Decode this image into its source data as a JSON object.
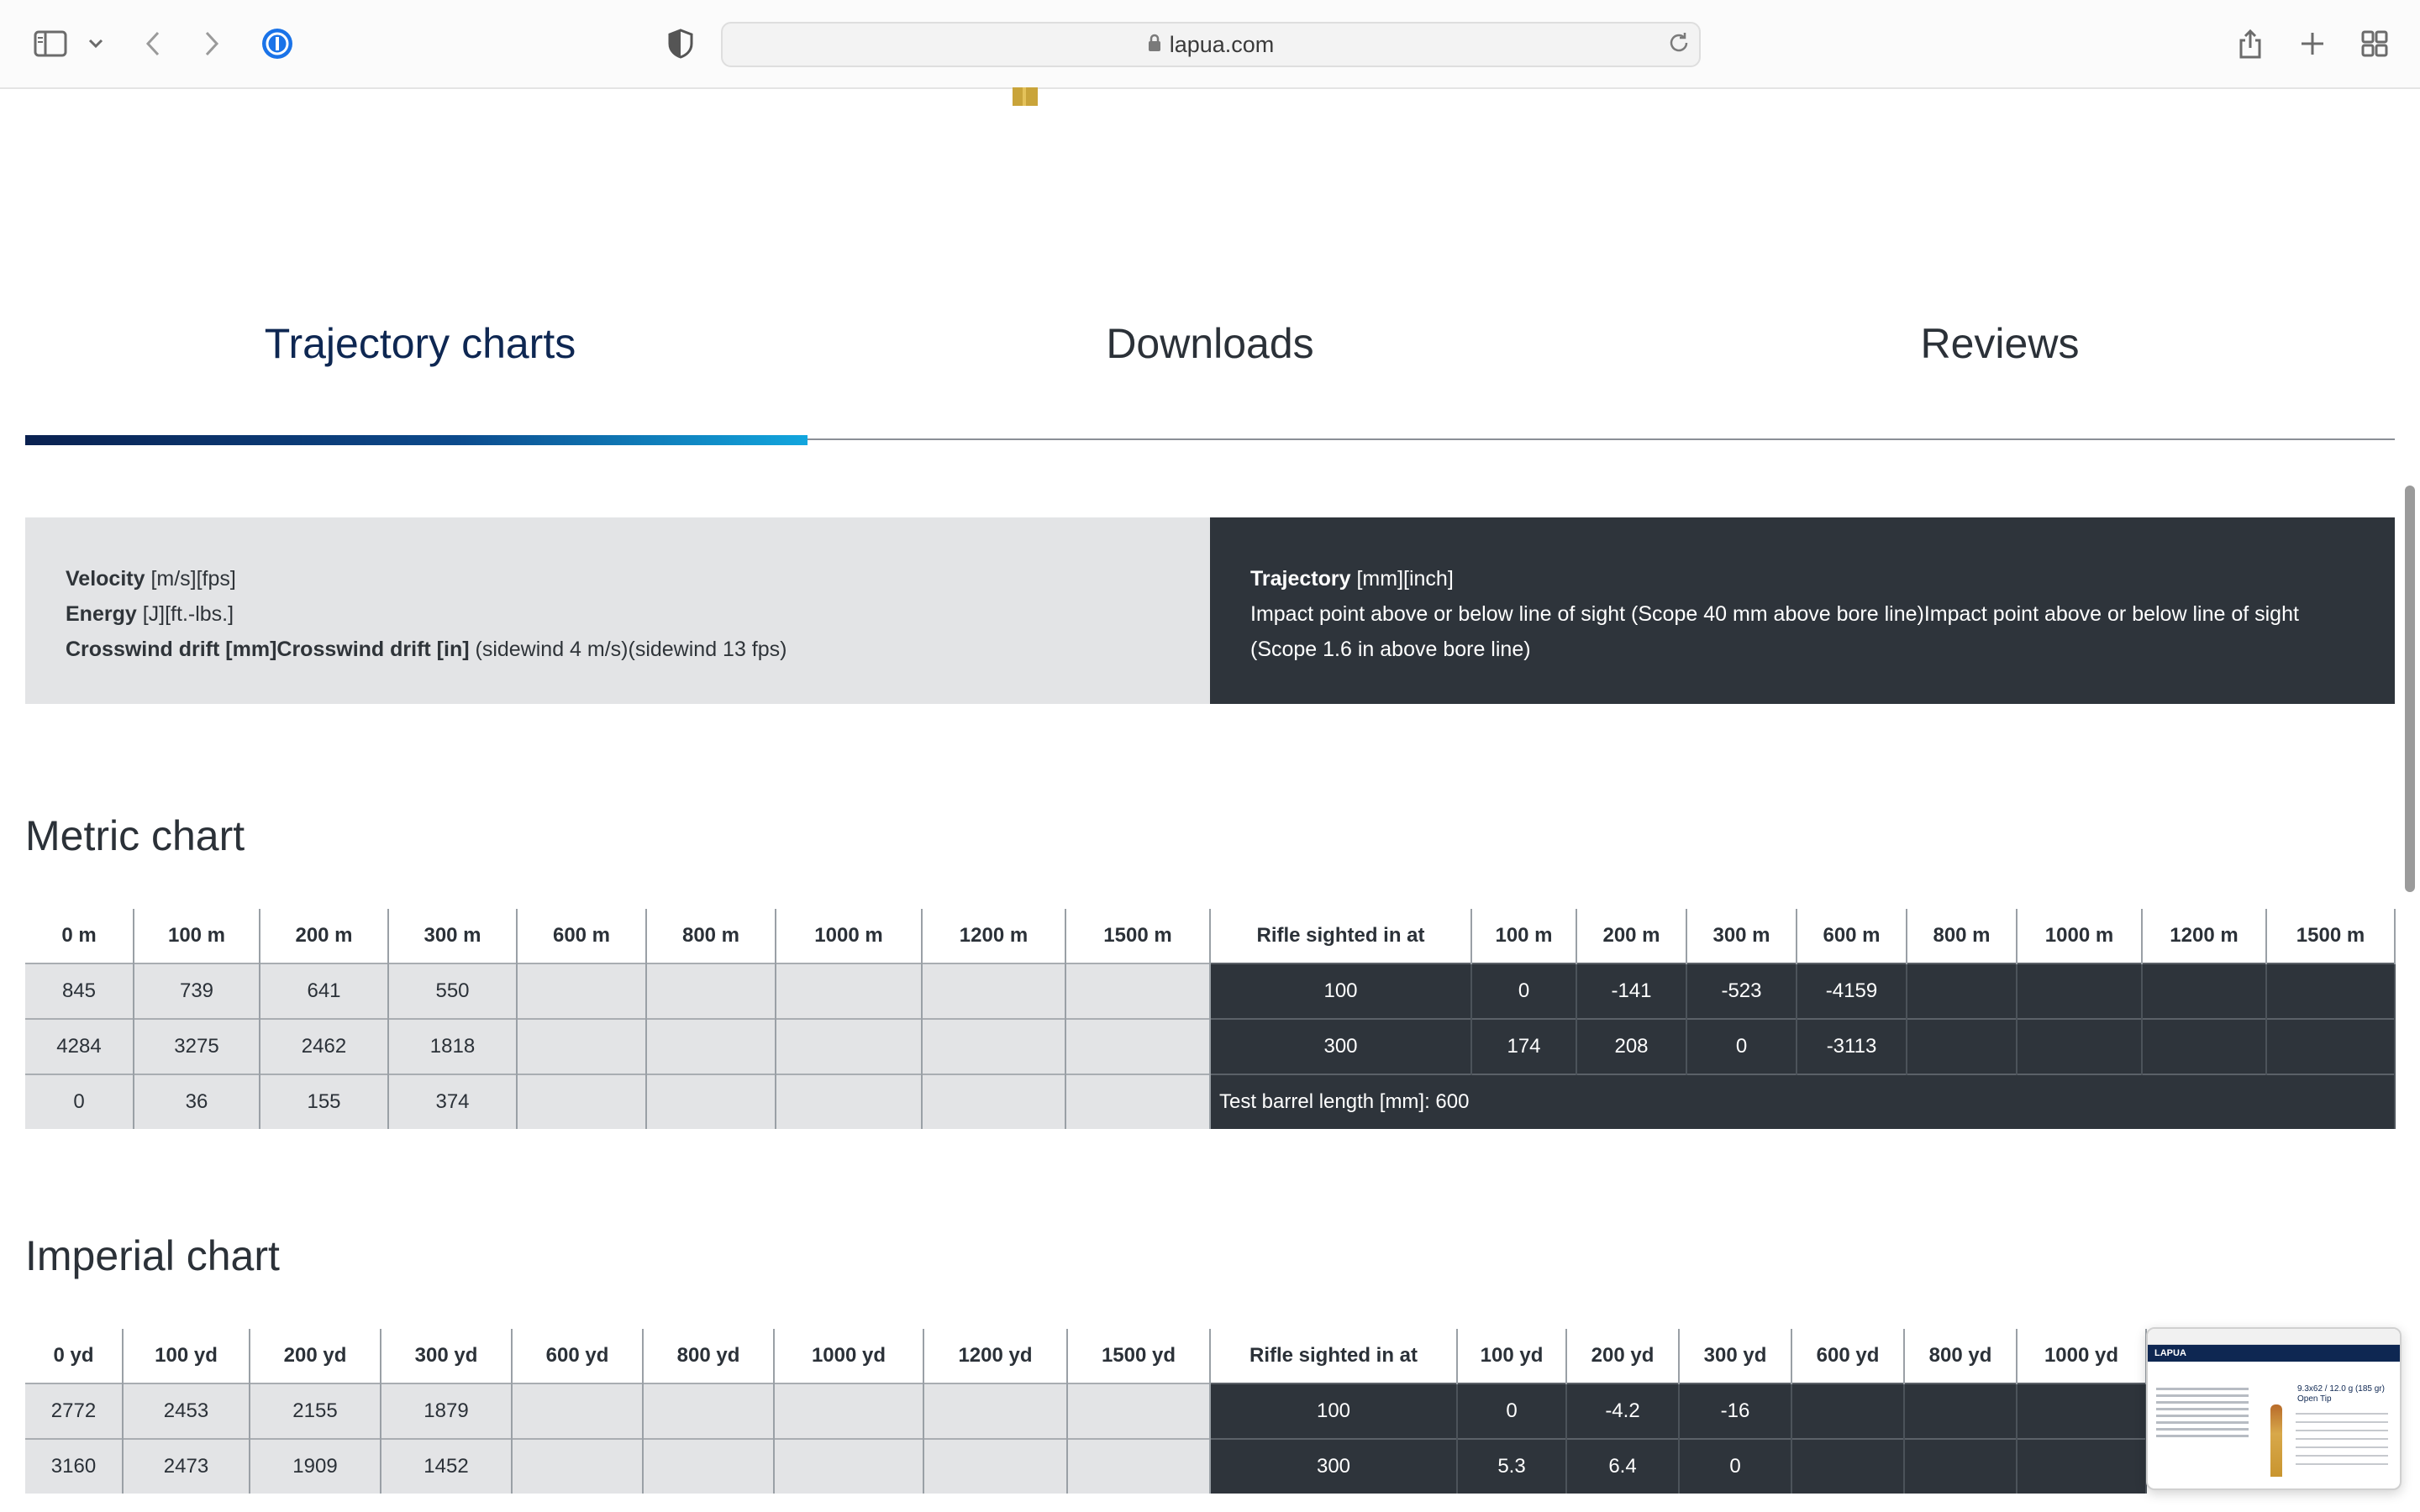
{
  "browser": {
    "url": "lapua.com"
  },
  "tabs": [
    {
      "label": "Trajectory charts",
      "active": true
    },
    {
      "label": "Downloads",
      "active": false
    },
    {
      "label": "Reviews",
      "active": false
    }
  ],
  "legend": {
    "velocity_label": "Velocity",
    "velocity_units": "[m/s][fps]",
    "energy_label": "Energy",
    "energy_units": "[J][ft.-lbs.]",
    "drift_label": "Crosswind drift [mm]Crosswind drift [in]",
    "drift_note": "(sidewind 4 m/s)(sidewind 13 fps)",
    "trajectory_label": "Trajectory",
    "trajectory_units": "[mm][inch]",
    "trajectory_note": "Impact point above or below line of sight (Scope 40 mm above bore line)Impact point above or below line of sight (Scope 1.6 in above bore line)"
  },
  "metric": {
    "title": "Metric chart",
    "left_headers": [
      "0 m",
      "100 m",
      "200 m",
      "300 m",
      "600 m",
      "800 m",
      "1000 m",
      "1200 m",
      "1500 m"
    ],
    "right_headers": [
      "Rifle sighted in at",
      "100 m",
      "200 m",
      "300 m",
      "600 m",
      "800 m",
      "1000 m",
      "1200 m",
      "1500 m"
    ],
    "left_rows": [
      [
        "845",
        "739",
        "641",
        "550",
        "",
        "",
        "",
        "",
        ""
      ],
      [
        "4284",
        "3275",
        "2462",
        "1818",
        "",
        "",
        "",
        "",
        ""
      ],
      [
        "0",
        "36",
        "155",
        "374",
        "",
        "",
        "",
        "",
        ""
      ]
    ],
    "right_rows": [
      [
        "100",
        "0",
        "-141",
        "-523",
        "-4159",
        "",
        "",
        "",
        ""
      ],
      [
        "300",
        "174",
        "208",
        "0",
        "-3113",
        "",
        "",
        "",
        ""
      ]
    ],
    "barrel_note": "Test barrel length [mm]: 600"
  },
  "imperial": {
    "title": "Imperial chart",
    "left_headers": [
      "0 yd",
      "100 yd",
      "200 yd",
      "300 yd",
      "600 yd",
      "800 yd",
      "1000 yd",
      "1200 yd",
      "1500 yd"
    ],
    "right_headers": [
      "Rifle sighted in at",
      "100 yd",
      "200 yd",
      "300 yd",
      "600 yd",
      "800 yd",
      "1000 yd"
    ],
    "left_rows": [
      [
        "2772",
        "2453",
        "2155",
        "1879",
        "",
        "",
        "",
        "",
        ""
      ],
      [
        "3160",
        "2473",
        "1909",
        "1452",
        "",
        "",
        "",
        "",
        ""
      ]
    ],
    "right_rows": [
      [
        "100",
        "0",
        "-4.2",
        "-16",
        "",
        "",
        ""
      ],
      [
        "300",
        "5.3",
        "6.4",
        "0",
        "",
        "",
        ""
      ]
    ]
  },
  "thumbnail": {
    "logo": "LAPUA",
    "title": "9.3x62 / 12.0 g (185 gr) Open Tip"
  },
  "colors": {
    "navy": "#0e2752",
    "dark_panel": "#2e343b",
    "light_panel": "#e3e4e6",
    "accent_blue": "#12a6de"
  }
}
